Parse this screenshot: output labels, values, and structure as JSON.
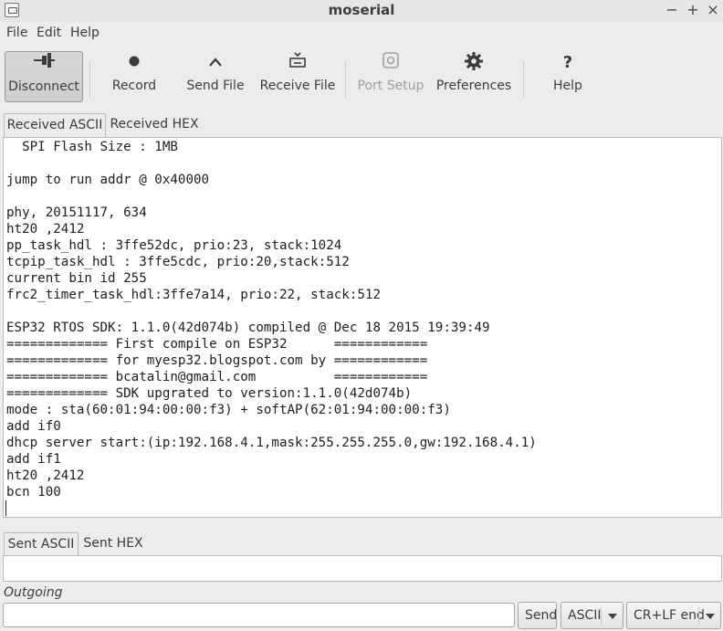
{
  "window": {
    "title": "moserial",
    "minimize": "−",
    "maximize": "+",
    "close": "×"
  },
  "menu": [
    "File",
    "Edit",
    "Help"
  ],
  "toolbar": {
    "disconnect": {
      "label": "Disconnect",
      "icon": "plug-icon"
    },
    "record": {
      "label": "Record",
      "icon": "record-dot-icon"
    },
    "send_file": {
      "label": "Send File",
      "icon": "chevron-up-icon"
    },
    "receive_file": {
      "label": "Receive File",
      "icon": "inbox-download-icon"
    },
    "port_setup": {
      "label": "Port Setup",
      "icon": "port-settings-icon"
    },
    "preferences": {
      "label": "Preferences",
      "icon": "gear-icon"
    },
    "help": {
      "label": "Help",
      "icon": "question-icon"
    }
  },
  "received_tabs": [
    "Received ASCII",
    "Received HEX"
  ],
  "received_text": "  SPI Flash Size : 1MB\n\njump to run addr @ 0x40000\n\nphy, 20151117, 634\nht20 ,2412\npp_task_hdl : 3ffe52dc, prio:23, stack:1024\ntcpip_task_hdl : 3ffe5cdc, prio:20,stack:512\ncurrent bin id 255\nfrc2_timer_task_hdl:3ffe7a14, prio:22, stack:512\n\nESP32 RTOS SDK: 1.1.0(42d074b) compiled @ Dec 18 2015 19:39:49\n============= First compile on ESP32      ============\n============= for myesp32.blogspot.com by ============\n============= bcatalin@gmail.com          ============\n============= SDK upgrated to version:1.1.0(42d074b)\nmode : sta(60:01:94:00:00:f3) + softAP(62:01:94:00:00:f3)\nadd if0\ndhcp server start:(ip:192.168.4.1,mask:255.255.255.0,gw:192.168.4.1)\nadd if1\nht20 ,2412\nbcn 100",
  "sent_tabs": [
    "Sent ASCII",
    "Sent HEX"
  ],
  "outgoing": {
    "label": "Outgoing",
    "value": "",
    "send": "Send",
    "format": "ASCII",
    "line_end": "CR+LF end"
  }
}
